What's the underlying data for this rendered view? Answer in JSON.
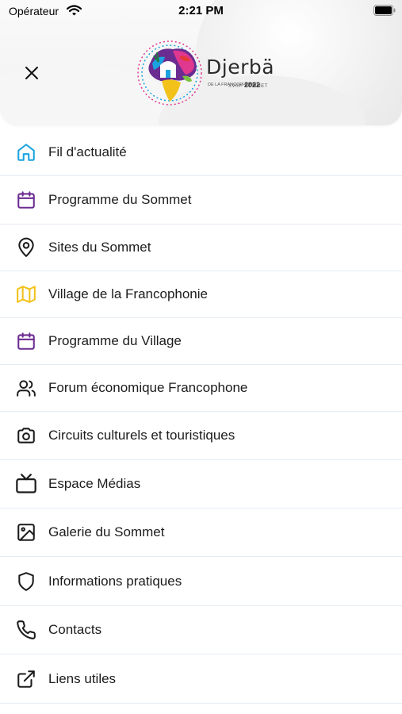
{
  "status_bar": {
    "carrier": "Opérateur",
    "time": "2:21 PM"
  },
  "header": {
    "logo": {
      "name": "Djerbä",
      "subtitle": "XVIIIᵉ SOMMET",
      "subtitle2": "DE LA FRANCOPHONIE",
      "year": "2022"
    }
  },
  "menu": {
    "items": [
      {
        "label": "Fil d'actualité",
        "icon": "home-icon",
        "color": "#1aa3e0"
      },
      {
        "label": "Programme du Sommet",
        "icon": "calendar-icon",
        "color": "#6b2c91"
      },
      {
        "label": "Sites du Sommet",
        "icon": "map-pin-icon",
        "color": "#1c1c1c"
      },
      {
        "label": "Village de la Francophonie",
        "icon": "map-icon",
        "color": "#f2c21b"
      },
      {
        "label": "Programme du Village",
        "icon": "calendar-icon",
        "color": "#6b2c91"
      },
      {
        "label": "Forum économique Francophone",
        "icon": "users-icon",
        "color": "#1c1c1c"
      },
      {
        "label": "Circuits culturels et touristiques",
        "icon": "camera-icon",
        "color": "#1c1c1c"
      },
      {
        "label": "Espace Médias",
        "icon": "tv-icon",
        "color": "#1c1c1c"
      },
      {
        "label": "Galerie du Sommet",
        "icon": "image-icon",
        "color": "#1c1c1c"
      },
      {
        "label": "Informations pratiques",
        "icon": "shield-icon",
        "color": "#1c1c1c"
      },
      {
        "label": "Contacts",
        "icon": "phone-icon",
        "color": "#1c1c1c"
      },
      {
        "label": "Liens utiles",
        "icon": "external-link-icon",
        "color": "#1c1c1c"
      }
    ]
  }
}
